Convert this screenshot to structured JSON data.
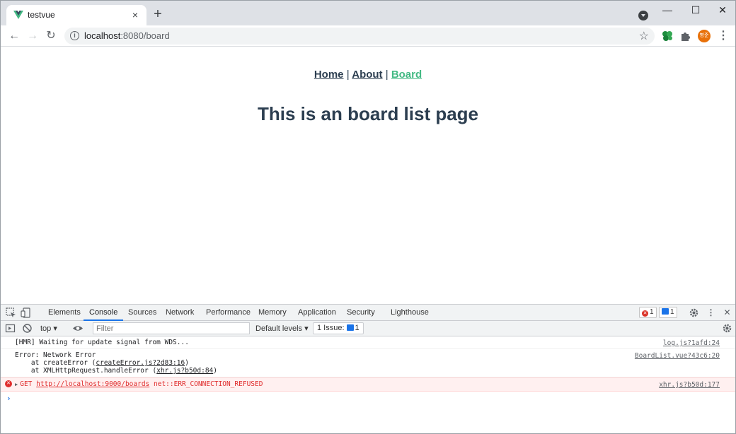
{
  "browser": {
    "tab": {
      "title": "testvue",
      "favicon": "vue-logo-icon",
      "close_icon": "×"
    },
    "new_tab_label": "+",
    "window_controls": {
      "minimize": "—",
      "maximize": "☐",
      "close": "✕"
    },
    "toolbar": {
      "back": "←",
      "forward": "→",
      "reload": "↻",
      "url_host": "localhost",
      "url_path": ":8080/board",
      "star": "☆",
      "profile_label": "병준",
      "menu": "⋮"
    }
  },
  "page": {
    "nav": [
      {
        "label": "Home",
        "active": false
      },
      {
        "label": "About",
        "active": false
      },
      {
        "label": "Board",
        "active": true
      }
    ],
    "separator": "|",
    "heading": "This is an board list page"
  },
  "devtools": {
    "tabs": [
      "Elements",
      "Console",
      "Sources",
      "Network",
      "Performance",
      "Memory",
      "Application",
      "Security",
      "Lighthouse"
    ],
    "active_tab": "Console",
    "error_count": "1",
    "message_count": "1",
    "context": "top",
    "filter_placeholder": "Filter",
    "levels_label": "Default levels",
    "issues_label": "1 Issue:",
    "issues_count": "1",
    "logs": [
      {
        "text": "[HMR] Waiting for update signal from WDS...",
        "source": "log.js?1afd:24"
      },
      {
        "text": "Error: Network Error",
        "trace1_pre": "    at createError (",
        "trace1_link": "createError.js?2d83:16",
        "trace1_post": ")",
        "trace2_pre": "    at XMLHttpRequest.handleError (",
        "trace2_link": "xhr.js?b50d:84",
        "trace2_post": ")",
        "source": "BoardList.vue?43c6:20"
      },
      {
        "method": "GET",
        "url": "http://localhost:9000/boards",
        "error": "net::ERR_CONNECTION_REFUSED",
        "source": "xhr.js?b50d:177"
      }
    ],
    "prompt": "›"
  },
  "colors": {
    "vue_green": "#42b983",
    "text_dark": "#2c3e50",
    "error_red": "#e02d2d",
    "devtools_blue": "#1a73e8"
  }
}
